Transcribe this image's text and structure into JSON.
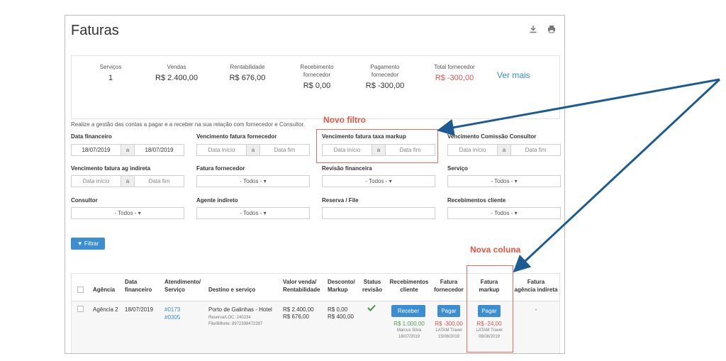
{
  "title": "Faturas",
  "icons": {
    "download": "download-icon",
    "print": "print-icon"
  },
  "summary": {
    "servicos_label": "Serviços",
    "servicos_value": "1",
    "vendas_label": "Vendas",
    "vendas_value": "R$ 2.400,00",
    "rent_label": "Rentabilidade",
    "rent_value": "R$ 676,00",
    "receb_label_1": "Recebimento",
    "receb_label_2": "fornecedor",
    "receb_value": "R$ 0,00",
    "pag_label_1": "Pagamento",
    "pag_label_2": "fornecedor",
    "pag_value": "R$ -300,00",
    "total_label": "Total fornecedor",
    "total_value": "R$ -300,00",
    "ver_mais": "Ver mais"
  },
  "intro": "Realize a gestão das contas a pagar e a receber na sua relação com fornecedor e Consultor.",
  "annotations": {
    "novo_filtro": "Novo filtro",
    "nova_coluna": "Nova coluna"
  },
  "filters": {
    "data_financeiro": {
      "label": "Data financeiro",
      "from": "18/07/2019",
      "sep": "a",
      "to": "18/07/2019"
    },
    "venc_fatura_fornecedor": {
      "label": "Vencimento fatura fornecedor",
      "from": "Data início",
      "sep": "a",
      "to": "Data fim"
    },
    "venc_fatura_markup": {
      "label": "Vencimento fatura taxa markup",
      "from": "Data início",
      "sep": "a",
      "to": "Data fim"
    },
    "venc_comissao": {
      "label": "Vencimento Comissão Consultor",
      "from": "Data início",
      "sep": "a",
      "to": "Data fim"
    },
    "venc_ag_indireta": {
      "label": "Vencimento fatura ag indireta",
      "from": "Data início",
      "sep": "a",
      "to": "Data fim"
    },
    "fatura_fornecedor": {
      "label": "Fatura fornecedor",
      "value": "- Todos -"
    },
    "revisao_financeira": {
      "label": "Revisão financeira",
      "value": "- Todos -"
    },
    "servico": {
      "label": "Serviço",
      "value": "- Todos -"
    },
    "consultor": {
      "label": "Consultor",
      "value": "- Todos -"
    },
    "agente_indireto": {
      "label": "Agente indireto",
      "value": "- Todos -"
    },
    "reserva_file": {
      "label": "Reserva / File",
      "value": ""
    },
    "recebimentos_cliente": {
      "label": "Recebimentos cliente",
      "value": "- Todos -"
    },
    "filtrar": "Filtrar"
  },
  "table": {
    "headers": {
      "agencia": "Agência",
      "data_fin_1": "Data",
      "data_fin_2": "financeiro",
      "atend_1": "Atendimento/",
      "atend_2": "Serviço",
      "destino": "Destino e serviço",
      "valor_1": "Valor venda/",
      "valor_2": "Rentabilidade",
      "desconto_1": "Desconto/",
      "desconto_2": "Markup",
      "status_1": "Status",
      "status_2": "revisão",
      "receb_1": "Recebimentos",
      "receb_2": "cliente",
      "fatforn_1": "Fatura",
      "fatforn_2": "fornecedor",
      "fatmark_1": "Fatura",
      "fatmark_2": "markup",
      "fatag_1": "Fatura",
      "fatag_2": "agência indireta"
    },
    "row": {
      "agencia": "Agência 2",
      "data": "18/07/2019",
      "atend_1": "#0173",
      "atend_2": "#0305",
      "destino": "Porto de Galinhas - Hotel",
      "reserva": "Reserva/LOC: 240234",
      "file": "File/Bilhete: 8972398472397",
      "valor": "R$ 2.400,00",
      "rent": "R$ 676,00",
      "desconto": "R$ 0,00",
      "markup": "R$ 400,00",
      "receber_btn": "Receber",
      "receb_valor": "R$ 1.000,00",
      "receb_nome": "Marcus Silva",
      "receb_data": "18/07/2019",
      "pagar_forn_btn": "Pagar",
      "forn_valor": "R$ -300,00",
      "forn_nome": "LATAM Travel",
      "forn_data": "15/08/2019",
      "pagar_markup_btn": "Pagar",
      "markup_valor": "R$ -24,00",
      "markup_nome": "LATAM Travel",
      "markup_data": "08/08/2019",
      "ag_indireta": "-"
    }
  },
  "colors": {
    "accent": "#3a8ed1",
    "highlight": "#e86a61",
    "arrow": "#1d5c93"
  }
}
